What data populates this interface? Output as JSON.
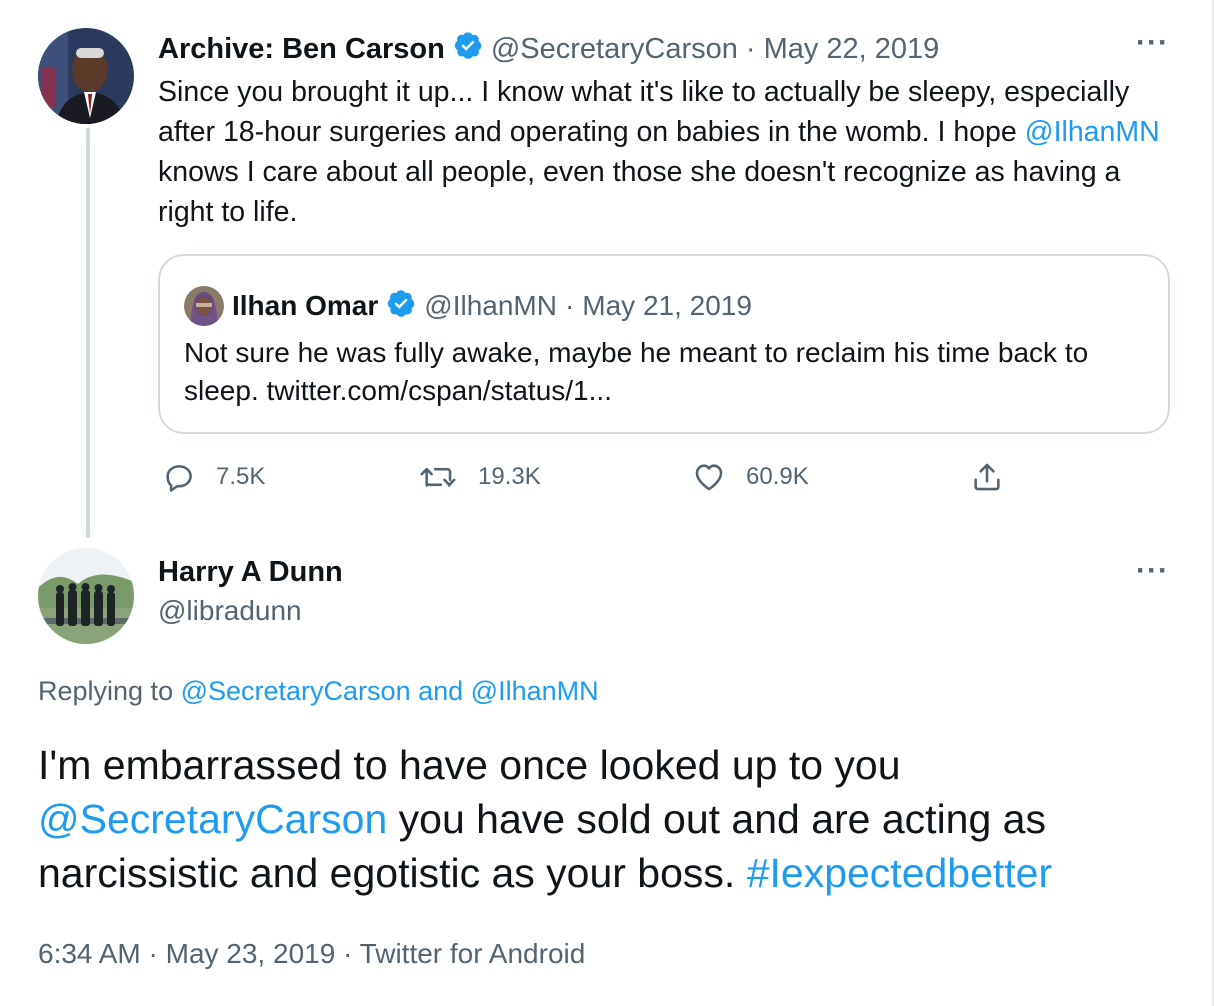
{
  "original_tweet": {
    "author_name": "Archive: Ben Carson",
    "handle": "@SecretaryCarson",
    "separator": "·",
    "date": "May 22, 2019",
    "text_1": "Since you brought it up... I know what it's like to actually be sleepy, especially after 18-hour surgeries and operating on babies in the womb. I hope ",
    "mention": "@IlhanMN",
    "text_2": " knows I care about all people, even those she doesn't recognize as having a right to life.",
    "more_label": "···",
    "quoted_tweet": {
      "author_name": "Ilhan Omar",
      "handle": "@IlhanMN",
      "separator": "·",
      "date": "May 21, 2019",
      "text": "Not sure he was fully awake, maybe he meant to reclaim his time back to sleep. twitter.com/cspan/status/1..."
    },
    "actions": {
      "replies": "7.5K",
      "retweets": "19.3K",
      "likes": "60.9K"
    }
  },
  "reply_tweet": {
    "author_name": "Harry A Dunn",
    "handle": "@libradunn",
    "more_label": "···",
    "replying_prefix": "Replying to ",
    "replying_to_1": "@SecretaryCarson",
    "replying_and": " and ",
    "replying_to_2": "@IlhanMN",
    "text_1": "I'm embarrassed to have once looked up to you ",
    "mention": "@SecretaryCarson",
    "text_2": " you have sold out and are acting as narcissistic and egotistic as your boss. ",
    "hashtag": "#Iexpectedbetter",
    "timestamp": "6:34 AM · May 23, 2019 · Twitter for Android"
  },
  "colors": {
    "link": "#1d9bf0",
    "muted": "#536471",
    "text": "#0f1419",
    "border": "#cfd9de"
  },
  "icons": [
    "verified-badge-icon",
    "reply-icon",
    "retweet-icon",
    "like-icon",
    "share-icon",
    "more-icon"
  ]
}
